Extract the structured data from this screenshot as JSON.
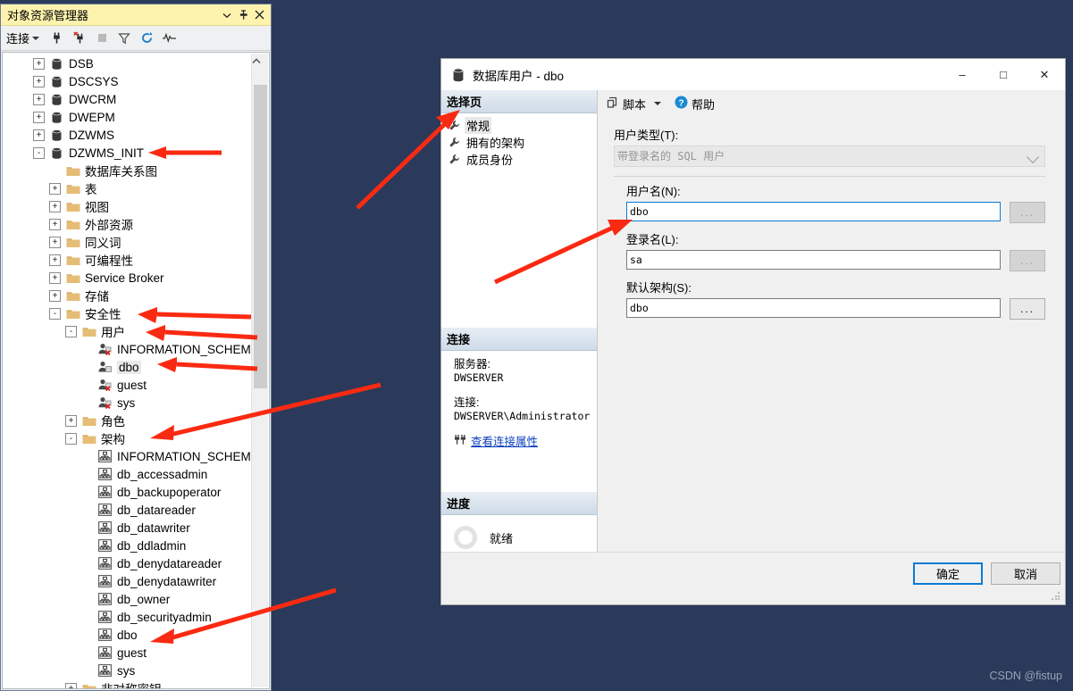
{
  "explorer": {
    "title": "对象资源管理器",
    "title_buttons": [
      "chevron-down-icon",
      "pin-icon",
      "close-icon"
    ],
    "toolbar": {
      "connect_label": "连接",
      "buttons": [
        "connect-icon",
        "disconnect-icon",
        "stop-icon",
        "filter-icon",
        "refresh-icon",
        "activity-monitor-icon"
      ]
    },
    "tree": [
      {
        "indent": 1,
        "expander": "+",
        "icon": "database-icon",
        "label": "DSB"
      },
      {
        "indent": 1,
        "expander": "+",
        "icon": "database-icon",
        "label": "DSCSYS"
      },
      {
        "indent": 1,
        "expander": "+",
        "icon": "database-icon",
        "label": "DWCRM"
      },
      {
        "indent": 1,
        "expander": "+",
        "icon": "database-icon",
        "label": "DWEPM"
      },
      {
        "indent": 1,
        "expander": "+",
        "icon": "database-icon",
        "label": "DZWMS"
      },
      {
        "indent": 1,
        "expander": "-",
        "icon": "database-icon",
        "label": "DZWMS_INIT"
      },
      {
        "indent": 2,
        "expander": "",
        "icon": "folder-icon",
        "label": "数据库关系图"
      },
      {
        "indent": 2,
        "expander": "+",
        "icon": "folder-icon",
        "label": "表"
      },
      {
        "indent": 2,
        "expander": "+",
        "icon": "folder-icon",
        "label": "视图"
      },
      {
        "indent": 2,
        "expander": "+",
        "icon": "folder-icon",
        "label": "外部资源"
      },
      {
        "indent": 2,
        "expander": "+",
        "icon": "folder-icon",
        "label": "同义词"
      },
      {
        "indent": 2,
        "expander": "+",
        "icon": "folder-icon",
        "label": "可编程性"
      },
      {
        "indent": 2,
        "expander": "+",
        "icon": "folder-icon",
        "label": "Service Broker"
      },
      {
        "indent": 2,
        "expander": "+",
        "icon": "folder-icon",
        "label": "存储"
      },
      {
        "indent": 2,
        "expander": "-",
        "icon": "folder-icon",
        "label": "安全性"
      },
      {
        "indent": 3,
        "expander": "-",
        "icon": "folder-icon",
        "label": "用户"
      },
      {
        "indent": 4,
        "expander": "",
        "icon": "user-blocked-icon",
        "label": "INFORMATION_SCHEMA"
      },
      {
        "indent": 4,
        "expander": "",
        "icon": "user-icon",
        "label": "dbo",
        "selected": true
      },
      {
        "indent": 4,
        "expander": "",
        "icon": "user-blocked-icon",
        "label": "guest"
      },
      {
        "indent": 4,
        "expander": "",
        "icon": "user-blocked-icon",
        "label": "sys"
      },
      {
        "indent": 3,
        "expander": "+",
        "icon": "folder-icon",
        "label": "角色"
      },
      {
        "indent": 3,
        "expander": "-",
        "icon": "folder-icon",
        "label": "架构"
      },
      {
        "indent": 4,
        "expander": "",
        "icon": "schema-icon",
        "label": "INFORMATION_SCHEMA"
      },
      {
        "indent": 4,
        "expander": "",
        "icon": "schema-icon",
        "label": "db_accessadmin"
      },
      {
        "indent": 4,
        "expander": "",
        "icon": "schema-icon",
        "label": "db_backupoperator"
      },
      {
        "indent": 4,
        "expander": "",
        "icon": "schema-icon",
        "label": "db_datareader"
      },
      {
        "indent": 4,
        "expander": "",
        "icon": "schema-icon",
        "label": "db_datawriter"
      },
      {
        "indent": 4,
        "expander": "",
        "icon": "schema-icon",
        "label": "db_ddladmin"
      },
      {
        "indent": 4,
        "expander": "",
        "icon": "schema-icon",
        "label": "db_denydatareader"
      },
      {
        "indent": 4,
        "expander": "",
        "icon": "schema-icon",
        "label": "db_denydatawriter"
      },
      {
        "indent": 4,
        "expander": "",
        "icon": "schema-icon",
        "label": "db_owner"
      },
      {
        "indent": 4,
        "expander": "",
        "icon": "schema-icon",
        "label": "db_securityadmin"
      },
      {
        "indent": 4,
        "expander": "",
        "icon": "schema-icon",
        "label": "dbo"
      },
      {
        "indent": 4,
        "expander": "",
        "icon": "schema-icon",
        "label": "guest"
      },
      {
        "indent": 4,
        "expander": "",
        "icon": "schema-icon",
        "label": "sys"
      },
      {
        "indent": 3,
        "expander": "+",
        "icon": "folder-icon",
        "label": "非对称密钥"
      }
    ]
  },
  "dialog": {
    "title": "数据库用户 - dbo",
    "window_buttons": {
      "minimize": "–",
      "maximize": "□",
      "close": "✕"
    },
    "select_page": {
      "header": "选择页",
      "items": [
        {
          "label": "常规",
          "active": true
        },
        {
          "label": "拥有的架构",
          "active": false
        },
        {
          "label": "成员身份",
          "active": false
        }
      ]
    },
    "connection": {
      "header": "连接",
      "server_label": "服务器:",
      "server_value": "DWSERVER",
      "connection_label": "连接:",
      "connection_value": "DWSERVER\\Administrator",
      "properties_link": "查看连接属性"
    },
    "progress": {
      "header": "进度",
      "status": "就绪"
    },
    "toolbar": {
      "script_label": "脚本",
      "help_label": "帮助"
    },
    "form": {
      "user_type_label": "用户类型(T):",
      "user_type_value": "带登录名的 SQL 用户",
      "user_type_options": [
        "带登录名的 SQL 用户"
      ],
      "user_name_label": "用户名(N):",
      "user_name_value": "dbo",
      "login_name_label": "登录名(L):",
      "login_name_value": "sa",
      "default_schema_label": "默认架构(S):",
      "default_schema_value": "dbo",
      "browse_label": "..."
    },
    "footer": {
      "ok_label": "确定",
      "cancel_label": "取消"
    }
  },
  "watermark": "CSDN @fistup",
  "colors": {
    "desktop_background": "#2b3a5a",
    "explorer_title_bar": "#fdf3ae",
    "accent_blue": "#0a7bd4",
    "arrow_red": "#fa2a12",
    "link_blue": "#0b3fbd"
  }
}
